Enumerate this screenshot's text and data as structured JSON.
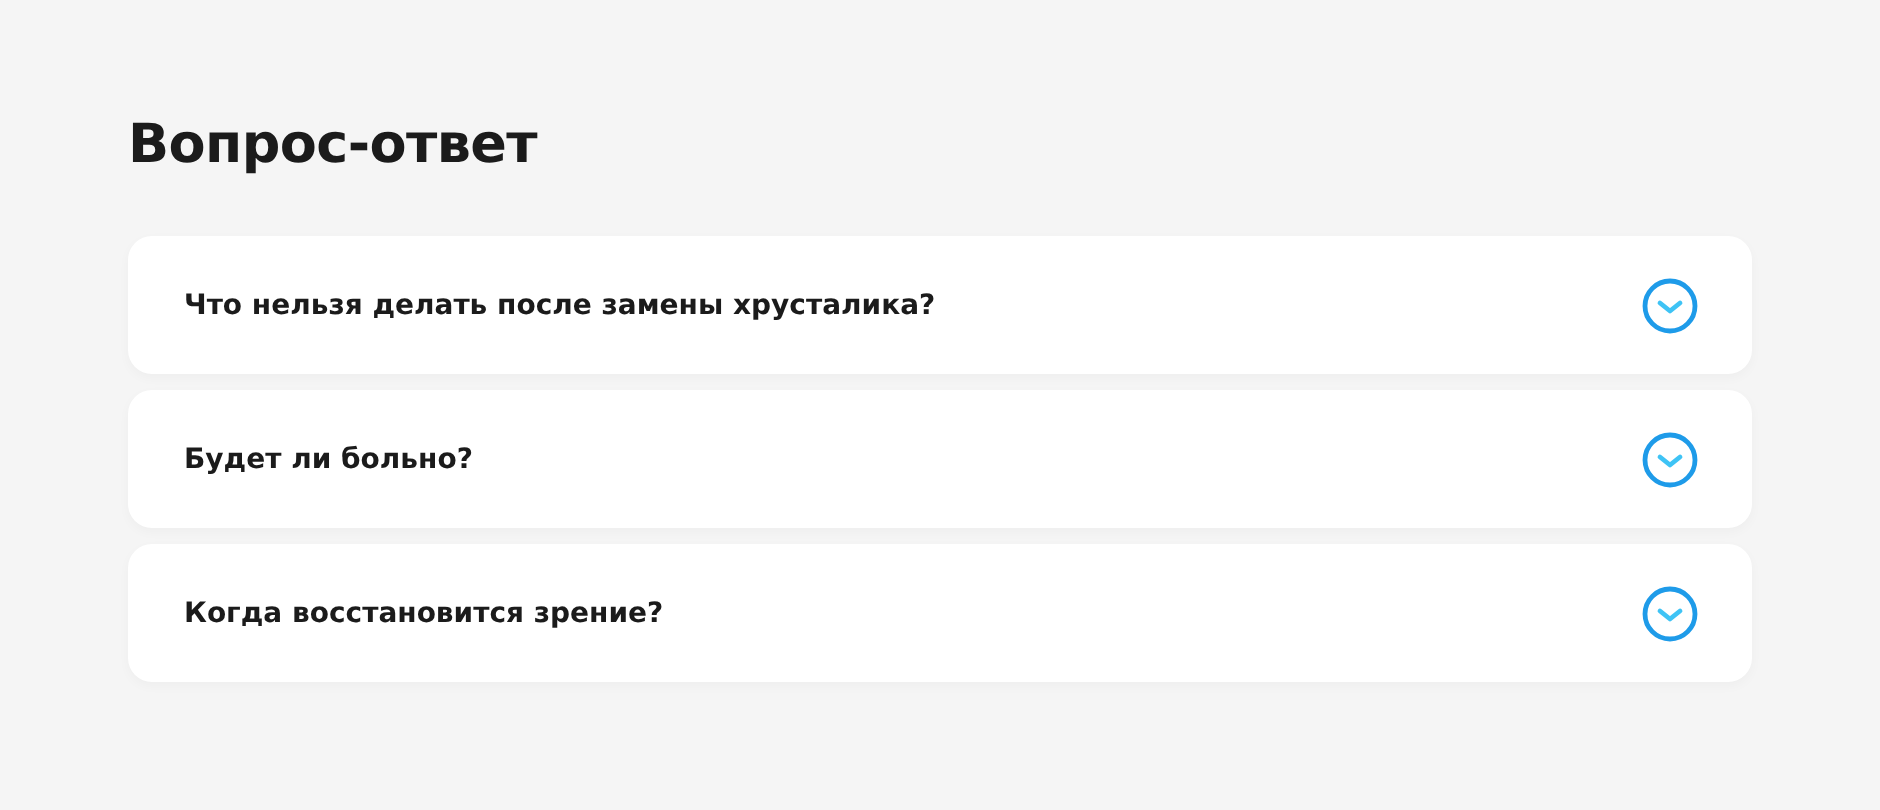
{
  "title": "Вопрос-ответ",
  "faq": [
    {
      "question": "Что нельзя делать после замены хрусталика?",
      "expanded": false
    },
    {
      "question": "Будет ли больно?",
      "expanded": false
    },
    {
      "question": "Когда восстановится зрение?",
      "expanded": false
    }
  ]
}
